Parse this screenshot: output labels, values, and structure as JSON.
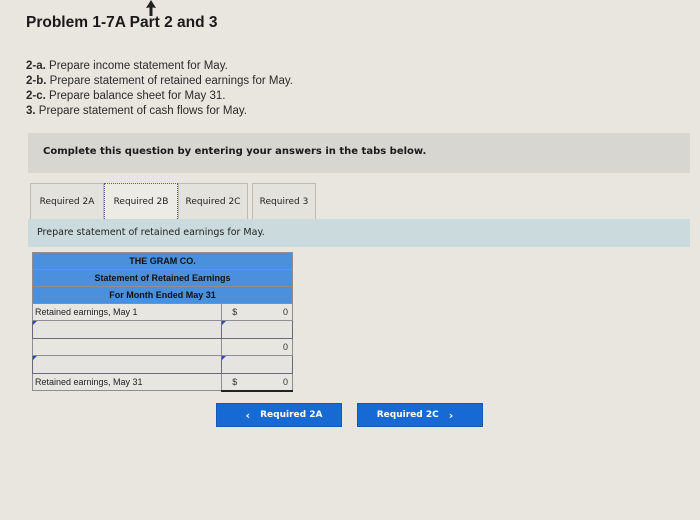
{
  "problem": {
    "title": "Problem 1-7A Part 2 and 3",
    "requirements": [
      {
        "label": "2-a.",
        "text": "Prepare income statement for May."
      },
      {
        "label": "2-b.",
        "text": "Prepare statement of retained earnings for May."
      },
      {
        "label": "2-c.",
        "text": "Prepare balance sheet for May 31."
      },
      {
        "label": "3.",
        "text": "Prepare statement of cash flows for May."
      }
    ]
  },
  "instructions": "Complete this question by entering your answers in the tabs below.",
  "tabs": [
    {
      "label": "Required 2A",
      "active": false
    },
    {
      "label": "Required 2B",
      "active": true
    },
    {
      "label": "Required 2C",
      "active": false
    },
    {
      "label": "Required 3",
      "active": false
    }
  ],
  "prompt": "Prepare statement of retained earnings for May.",
  "statement": {
    "company": "THE GRAM CO.",
    "name": "Statement of Retained Earnings",
    "period": "For Month Ended May 31",
    "rows": [
      {
        "label": "Retained earnings, May 1",
        "currency": "$",
        "value": "0"
      },
      {
        "label": "",
        "currency": "",
        "value": ""
      },
      {
        "label": "",
        "currency": "",
        "value": "0"
      },
      {
        "label": "",
        "currency": "",
        "value": ""
      },
      {
        "label": "Retained earnings, May 31",
        "currency": "$",
        "value": "0"
      }
    ]
  },
  "nav": {
    "prev_label": "Required 2A",
    "next_label": "Required 2C",
    "prev_icon": "‹",
    "next_icon": "›"
  },
  "colors": {
    "header_blue": "#4a90dc",
    "button_blue": "#1769d3",
    "prompt_bar": "#cbdadc"
  }
}
